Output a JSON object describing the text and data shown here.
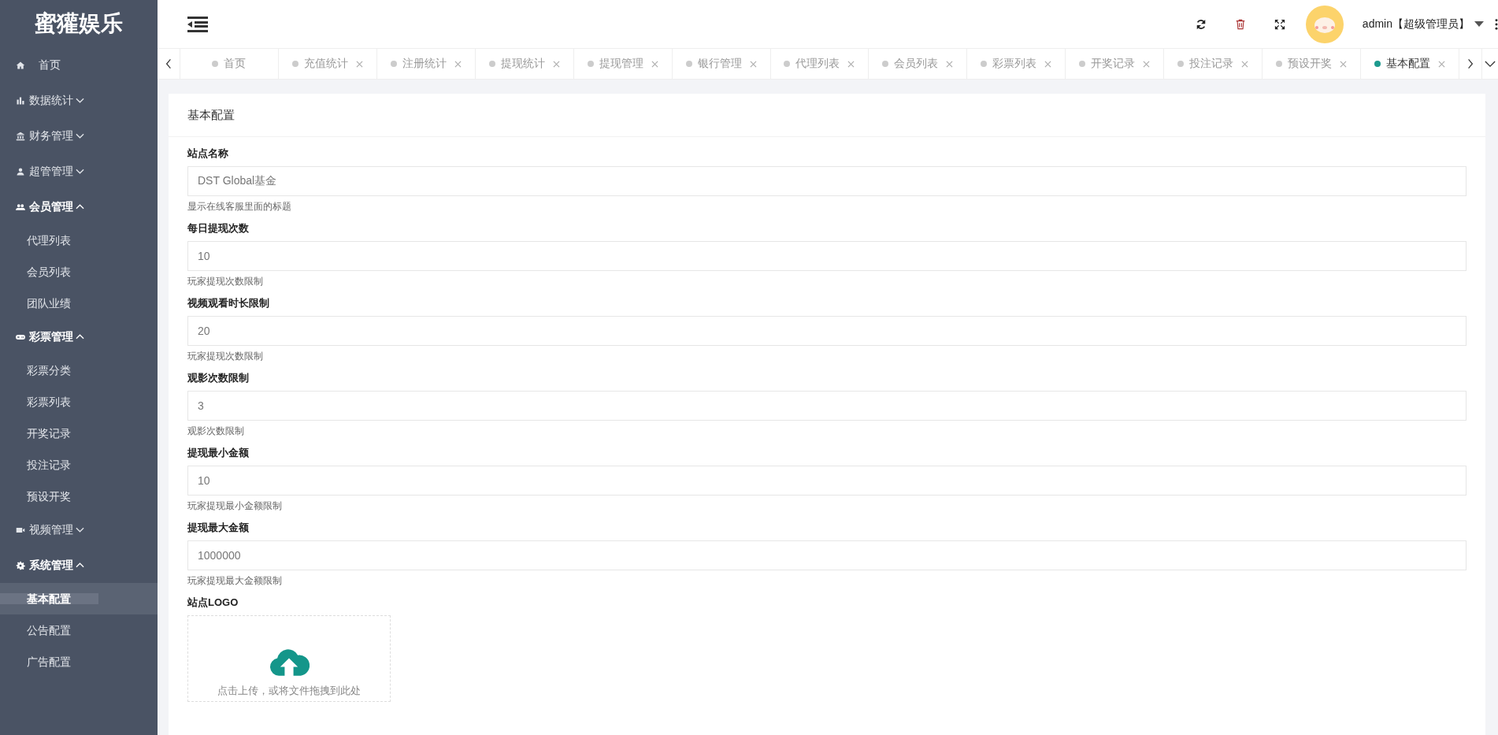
{
  "sidebar": {
    "logo": "蜜獾娱乐",
    "items": [
      {
        "label": "首页",
        "kind": "link"
      },
      {
        "label": "数据统计",
        "kind": "group",
        "expanded": false
      },
      {
        "label": "财务管理",
        "kind": "group",
        "expanded": false
      },
      {
        "label": "超管管理",
        "kind": "group",
        "expanded": false
      },
      {
        "label": "会员管理",
        "kind": "group",
        "expanded": true,
        "children": [
          {
            "label": "代理列表",
            "selected": false
          },
          {
            "label": "会员列表",
            "selected": false
          },
          {
            "label": "团队业绩",
            "selected": false
          }
        ]
      },
      {
        "label": "彩票管理",
        "kind": "group",
        "expanded": true,
        "children": [
          {
            "label": "彩票分类",
            "selected": false
          },
          {
            "label": "彩票列表",
            "selected": false
          },
          {
            "label": "开奖记录",
            "selected": false
          },
          {
            "label": "投注记录",
            "selected": false
          },
          {
            "label": "预设开奖",
            "selected": false
          }
        ]
      },
      {
        "label": "视频管理",
        "kind": "group",
        "expanded": false
      },
      {
        "label": "系统管理",
        "kind": "group",
        "expanded": true,
        "children": [
          {
            "label": "基本配置",
            "selected": true
          },
          {
            "label": "公告配置",
            "selected": false
          },
          {
            "label": "广告配置",
            "selected": false
          }
        ]
      }
    ]
  },
  "header": {
    "user": "admin【超级管理员】"
  },
  "tabs": [
    {
      "label": "首页",
      "selected": false,
      "closable": false
    },
    {
      "label": "充值统计",
      "selected": false,
      "closable": true
    },
    {
      "label": "注册统计",
      "selected": false,
      "closable": true
    },
    {
      "label": "提现统计",
      "selected": false,
      "closable": true
    },
    {
      "label": "提现管理",
      "selected": false,
      "closable": true
    },
    {
      "label": "银行管理",
      "selected": false,
      "closable": true
    },
    {
      "label": "代理列表",
      "selected": false,
      "closable": true
    },
    {
      "label": "会员列表",
      "selected": false,
      "closable": true
    },
    {
      "label": "彩票列表",
      "selected": false,
      "closable": true
    },
    {
      "label": "开奖记录",
      "selected": false,
      "closable": true
    },
    {
      "label": "投注记录",
      "selected": false,
      "closable": true
    },
    {
      "label": "预设开奖",
      "selected": false,
      "closable": true
    },
    {
      "label": "基本配置",
      "selected": true,
      "closable": true
    }
  ],
  "card": {
    "title": "基本配置",
    "fields": [
      {
        "label": "站点名称",
        "value": "DST Global基金",
        "help": "显示在线客服里面的标题"
      },
      {
        "label": "每日提现次数",
        "value": "10",
        "help": "玩家提现次数限制"
      },
      {
        "label": "视频观看时长限制",
        "value": "20",
        "help": "玩家提现次数限制"
      },
      {
        "label": "观影次数限制",
        "value": "3",
        "help": "观影次数限制"
      },
      {
        "label": "提现最小金额",
        "value": "10",
        "help": "玩家提现最小金额限制"
      },
      {
        "label": "提现最大金额",
        "value": "1000000",
        "help": "玩家提现最大金额限制"
      }
    ],
    "upload": {
      "label": "站点LOGO",
      "text": "点击上传，或将文件拖拽到此处"
    }
  }
}
